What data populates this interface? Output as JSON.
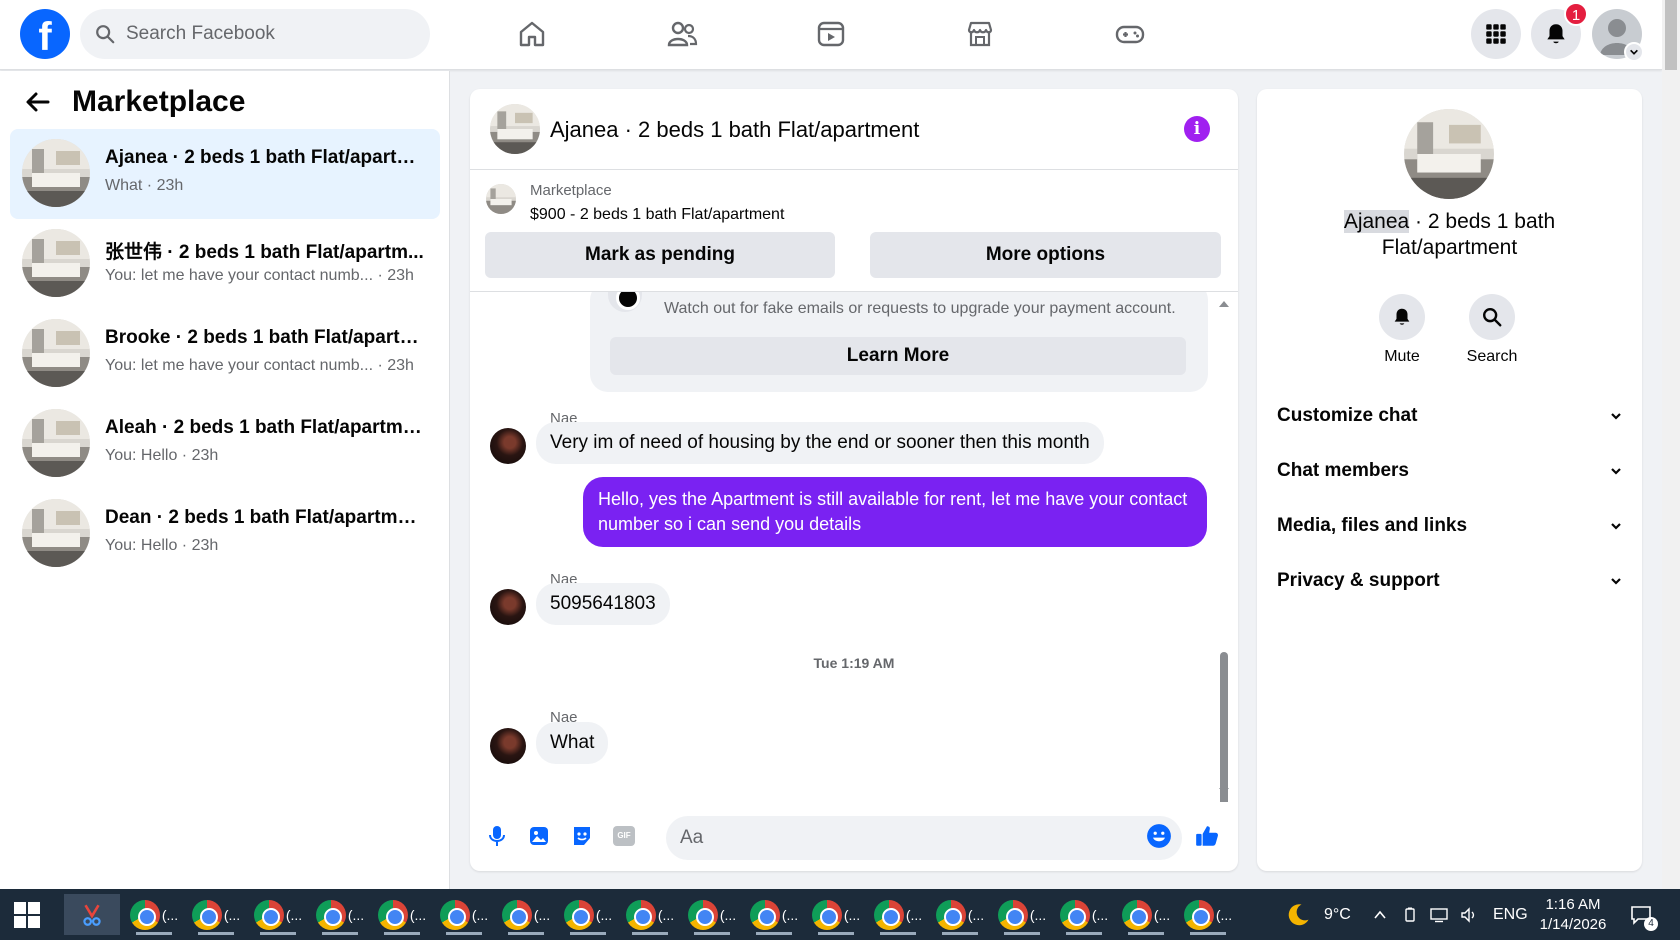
{
  "topbar": {
    "logo": "f",
    "search_placeholder": "Search Facebook",
    "notifications_count": "1"
  },
  "left": {
    "title": "Marketplace",
    "conversations": [
      {
        "title": "Ajanea · 2 beds 1 bath Flat/apartm...",
        "subtitle": "What · 23h"
      },
      {
        "title": "张世伟 · 2 beds 1 bath Flat/apartm...",
        "subtitle": "You: let me have your contact numb... · 23h"
      },
      {
        "title": "Brooke · 2 beds 1 bath Flat/apartm...",
        "subtitle": "You: let me have your contact numb... · 23h"
      },
      {
        "title": "Aleah · 2 beds 1 bath Flat/apartment",
        "subtitle": "You: Hello · 23h"
      },
      {
        "title": "Dean · 2 beds 1 bath Flat/apartment",
        "subtitle": "You: Hello · 23h"
      }
    ]
  },
  "chat": {
    "title": "Ajanea · 2 beds 1 bath Flat/apartment",
    "info_icon": "i",
    "marketplace_label": "Marketplace",
    "listing": "$900 - 2 beds 1 bath Flat/apartment",
    "mark_pending": "Mark as pending",
    "more_options": "More options",
    "warning_text": "Watch out for fake emails or requests to upgrade your payment account.",
    "learn_more": "Learn More",
    "messages": [
      {
        "sender": "Nae",
        "text": "Very im of need of housing by the end or sooner then this month"
      },
      {
        "sender": "You",
        "text": "Hello, yes the Apartment is still available for rent, let me have your contact number so i can send you details"
      },
      {
        "sender": "Nae",
        "text": "5095641803"
      },
      {
        "sender": "Nae",
        "text": "What"
      }
    ],
    "timestamp": "Tue 1:19 AM",
    "composer_placeholder": "Aa",
    "composer_gif": "GIF"
  },
  "right": {
    "name_highlight": "Ajanea",
    "title_rest_line1": " · 2 beds 1 bath",
    "title_line2": "Flat/apartment",
    "mute": "Mute",
    "search": "Search",
    "sections": [
      "Customize chat",
      "Chat members",
      "Media, files and links",
      "Privacy & support"
    ]
  },
  "taskbar": {
    "temperature": "9°C",
    "language": "ENG",
    "time": "1:16 AM",
    "date": "1/14/2026",
    "app_label": "(...",
    "notification_count": "4"
  },
  "colors": {
    "brand": "#0866ff",
    "outgoing_bubble": "#7a22f2",
    "active_conversation": "#e7f3ff"
  }
}
